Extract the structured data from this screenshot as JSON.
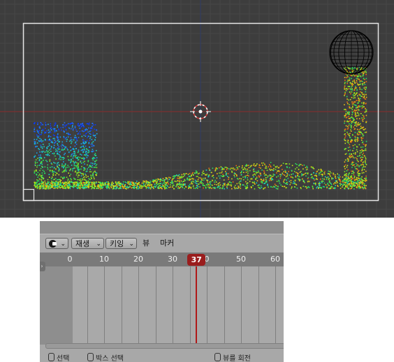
{
  "viewport": {
    "colors": {
      "background": "#3d3d3d",
      "grid": "#474747",
      "x_axis": "#8a2a2a",
      "y_axis": "#2e3c66",
      "frame": "#e6e6e6"
    },
    "icons": [
      "3d-cursor-icon",
      "sphere-wireframe-icon"
    ]
  },
  "timeline": {
    "header": {
      "editor_type_icon": "clock-icon",
      "play_menu": "재생",
      "key_menu": "키잉",
      "view_menu": "뷰",
      "marker_menu": "마커"
    },
    "ruler": {
      "ticks": [
        {
          "label": "0",
          "frame": 0
        },
        {
          "label": "10",
          "frame": 10
        },
        {
          "label": "20",
          "frame": 20
        },
        {
          "label": "30",
          "frame": 30
        },
        {
          "label": "0",
          "frame": 40
        },
        {
          "label": "50",
          "frame": 50
        },
        {
          "label": "60",
          "frame": 60
        }
      ],
      "current_frame": "37"
    },
    "status": {
      "select": "선택",
      "box_select": "박스 선택",
      "view_rotate": "뷰를 회전"
    },
    "colors": {
      "playhead": "#b01818"
    }
  }
}
